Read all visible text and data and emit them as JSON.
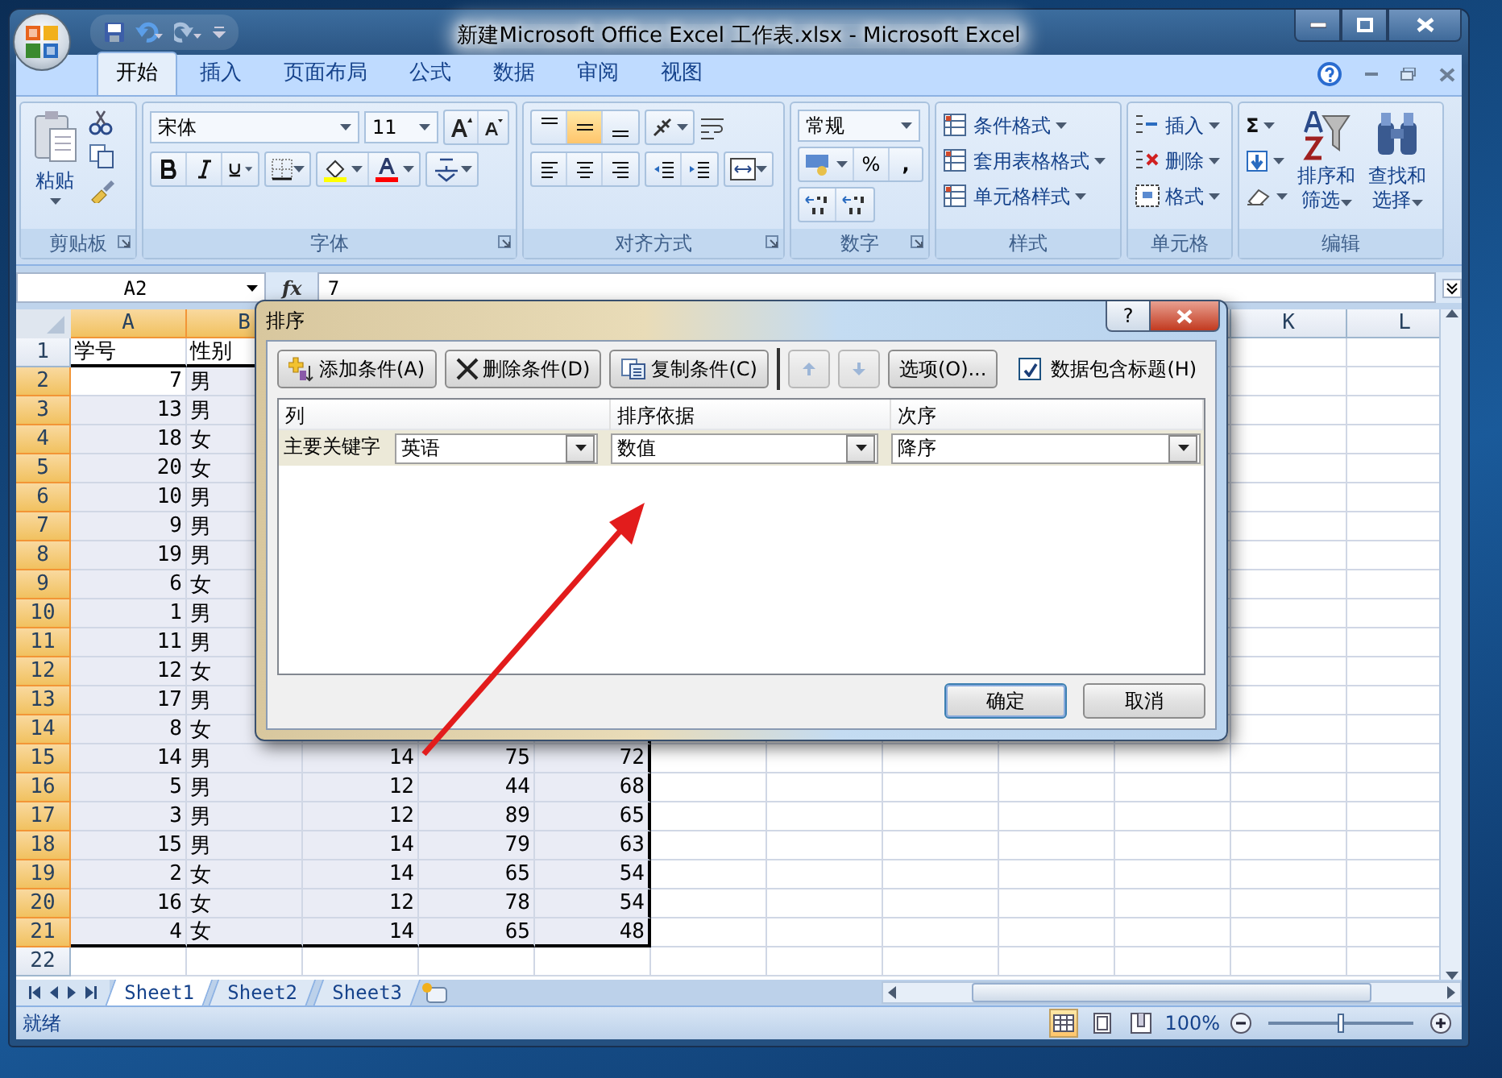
{
  "window": {
    "title": "新建Microsoft Office Excel 工作表.xlsx - Microsoft Excel"
  },
  "ribbon_tabs": [
    {
      "label": "开始",
      "selected": true
    },
    {
      "label": "插入",
      "selected": false
    },
    {
      "label": "页面布局",
      "selected": false
    },
    {
      "label": "公式",
      "selected": false
    },
    {
      "label": "数据",
      "selected": false
    },
    {
      "label": "审阅",
      "selected": false
    },
    {
      "label": "视图",
      "selected": false
    }
  ],
  "ribbon_groups": [
    {
      "kind": "clipboard",
      "label": "剪贴板",
      "paste": "粘贴"
    },
    {
      "kind": "font",
      "label": "字体",
      "font_name": "宋体",
      "font_size": "11"
    },
    {
      "kind": "alignment",
      "label": "对齐方式",
      "vertical_align": [
        {
          "selected": false
        },
        {
          "selected": true
        },
        {
          "selected": false
        }
      ]
    },
    {
      "kind": "number",
      "label": "数字",
      "format": "常规",
      "percent": "%",
      "comma": ","
    },
    {
      "kind": "styles",
      "label": "样式",
      "items": [
        "条件格式",
        "套用表格格式",
        "单元格样式"
      ]
    },
    {
      "kind": "cells",
      "label": "单元格",
      "items": [
        "插入",
        "删除",
        "格式"
      ]
    },
    {
      "kind": "editing",
      "label": "编辑",
      "sigma": "Σ",
      "sort_lines": [
        "排序和",
        "筛选"
      ],
      "find_lines": [
        "查找和",
        "选择"
      ]
    }
  ],
  "formula_bar": {
    "name_box": "A2",
    "function_label": "fx",
    "formula": "7"
  },
  "column_headers_left": [
    {
      "label": "A",
      "selected": true
    },
    {
      "label": "B",
      "selected": true
    }
  ],
  "column_headers_right": [
    {
      "label": "K",
      "selected": false
    },
    {
      "label": "L",
      "selected": false
    }
  ],
  "rows": [
    {
      "header": "1",
      "selected": false,
      "cells": [
        "学号",
        "性别",
        null,
        null,
        null
      ]
    },
    {
      "header": "2",
      "selected": true,
      "cells": [
        "7",
        "男",
        null,
        null,
        null
      ]
    },
    {
      "header": "3",
      "selected": true,
      "cells": [
        "13",
        "男",
        null,
        null,
        null
      ]
    },
    {
      "header": "4",
      "selected": true,
      "cells": [
        "18",
        "女",
        null,
        null,
        null
      ]
    },
    {
      "header": "5",
      "selected": true,
      "cells": [
        "20",
        "女",
        null,
        null,
        null
      ]
    },
    {
      "header": "6",
      "selected": true,
      "cells": [
        "10",
        "男",
        null,
        null,
        null
      ]
    },
    {
      "header": "7",
      "selected": true,
      "cells": [
        "9",
        "男",
        null,
        null,
        null
      ]
    },
    {
      "header": "8",
      "selected": true,
      "cells": [
        "19",
        "男",
        null,
        null,
        null
      ]
    },
    {
      "header": "9",
      "selected": true,
      "cells": [
        "6",
        "女",
        null,
        null,
        null
      ]
    },
    {
      "header": "10",
      "selected": true,
      "cells": [
        "1",
        "男",
        null,
        null,
        null
      ]
    },
    {
      "header": "11",
      "selected": true,
      "cells": [
        "11",
        "男",
        null,
        null,
        null
      ]
    },
    {
      "header": "12",
      "selected": true,
      "cells": [
        "12",
        "女",
        null,
        null,
        null
      ]
    },
    {
      "header": "13",
      "selected": true,
      "cells": [
        "17",
        "男",
        null,
        null,
        null
      ]
    },
    {
      "header": "14",
      "selected": true,
      "cells": [
        "8",
        "女",
        null,
        null,
        null
      ]
    },
    {
      "header": "15",
      "selected": true,
      "cells": [
        "14",
        "男",
        "14",
        "75",
        "72"
      ]
    },
    {
      "header": "16",
      "selected": true,
      "cells": [
        "5",
        "男",
        "12",
        "44",
        "68"
      ]
    },
    {
      "header": "17",
      "selected": true,
      "cells": [
        "3",
        "男",
        "12",
        "89",
        "65"
      ]
    },
    {
      "header": "18",
      "selected": true,
      "cells": [
        "15",
        "男",
        "14",
        "79",
        "63"
      ]
    },
    {
      "header": "19",
      "selected": true,
      "cells": [
        "2",
        "女",
        "14",
        "65",
        "54"
      ]
    },
    {
      "header": "20",
      "selected": true,
      "cells": [
        "16",
        "女",
        "12",
        "78",
        "54"
      ]
    },
    {
      "header": "21",
      "selected": true,
      "cells": [
        "4",
        "女",
        "14",
        "65",
        "48"
      ]
    },
    {
      "header": "22",
      "selected": false,
      "cells": []
    }
  ],
  "sheet_tabs": [
    {
      "label": "Sheet1",
      "selected": true
    },
    {
      "label": "Sheet2",
      "selected": false
    },
    {
      "label": "Sheet3",
      "selected": false
    }
  ],
  "status_bar": {
    "status": "就绪",
    "views": [
      {
        "kind": "normal",
        "selected": true
      },
      {
        "kind": "layout",
        "selected": false
      },
      {
        "kind": "break",
        "selected": false
      }
    ],
    "zoom": "100%",
    "zoom_slider": {
      "level": 0.5
    }
  },
  "sort_dialog": {
    "title": "排序",
    "help": "?",
    "toolbar": [
      {
        "kind": "add",
        "label": "添加条件(A)",
        "disabled": false
      },
      {
        "kind": "delete",
        "label": "删除条件(D)",
        "disabled": false
      },
      {
        "kind": "copy",
        "label": "复制条件(C)",
        "disabled": false
      },
      {
        "kind": "up",
        "disabled": true
      },
      {
        "kind": "down",
        "disabled": true
      },
      {
        "kind": "options",
        "label": "选项(O)...",
        "disabled": false
      }
    ],
    "has_headers": {
      "label": "数据包含标题(H)",
      "checked": true
    },
    "columns": [
      "列",
      "排序依据",
      "次序"
    ],
    "levels": [
      {
        "label": "主要关键字",
        "column": "英语",
        "sort_on": "数值",
        "order": "降序"
      }
    ],
    "buttons": [
      {
        "label": "确定",
        "default": true
      },
      {
        "label": "取消",
        "default": false
      }
    ]
  }
}
